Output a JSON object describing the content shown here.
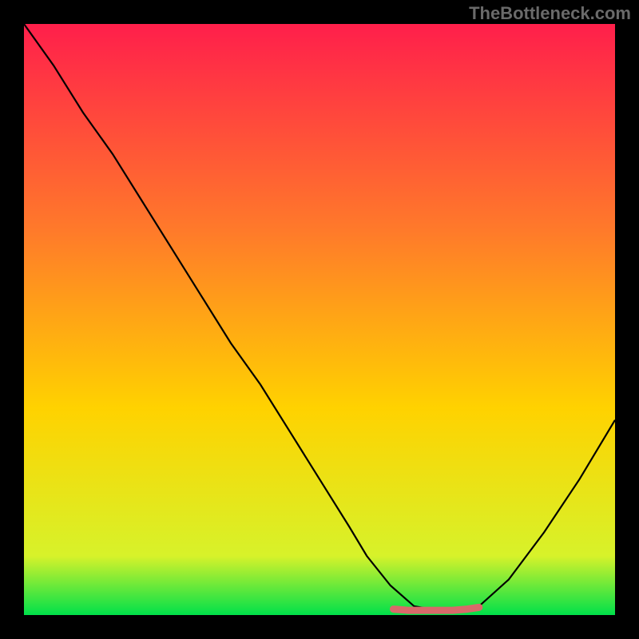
{
  "watermark": "TheBottleneck.com",
  "chart_data": {
    "type": "line",
    "title": "",
    "xlabel": "",
    "ylabel": "",
    "xlim": [
      0,
      100
    ],
    "ylim": [
      0,
      100
    ],
    "background_gradient": {
      "top": "#ff1f4b",
      "mid": "#ffd200",
      "bottom": "#00e04a"
    },
    "curve": {
      "x": [
        0,
        5,
        10,
        15,
        20,
        25,
        30,
        35,
        40,
        45,
        50,
        55,
        58,
        62,
        66,
        70,
        73,
        77,
        82,
        88,
        94,
        100
      ],
      "y": [
        100,
        93,
        85,
        78,
        70,
        62,
        54,
        46,
        39,
        31,
        23,
        15,
        10,
        5,
        1.5,
        0.8,
        0.8,
        1.5,
        6,
        14,
        23,
        33
      ]
    },
    "flat_marker": {
      "color": "#d86a6a",
      "x": [
        62.5,
        65,
        67.5,
        70,
        72.5,
        75,
        77
      ],
      "y": [
        1.0,
        0.8,
        0.8,
        0.8,
        0.8,
        1.0,
        1.3
      ]
    }
  }
}
